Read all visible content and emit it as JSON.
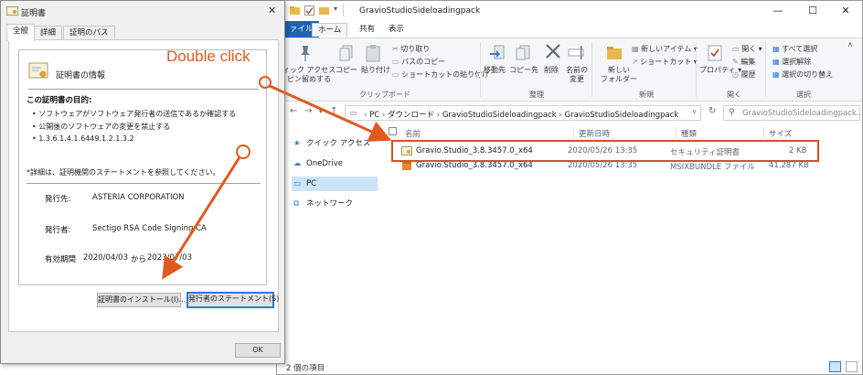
{
  "explorer": {
    "title": "GravioStudioSideloadingpack",
    "tabs": [
      "ァイル",
      "ホーム",
      "共有",
      "表示"
    ],
    "ribbon": {
      "pin_label": "ィック アクセス\nピン留めする",
      "copy_label": "コピー",
      "paste_label": "貼り付け",
      "cut": "切り取り",
      "copy_path": "パスのコピー",
      "paste_shortcut": "ショートカットの貼り付け",
      "clipboard_group": "クリップボード",
      "move_to": "移動先",
      "copy_to": "コピー先",
      "delete": "削除",
      "rename": "名前の\n変更",
      "organize_group": "整理",
      "new_folder": "新しい\nフォルダー",
      "new_item": "新しいアイテム",
      "shortcut": "ショートカット",
      "new_group": "新規",
      "properties": "プロパティ",
      "open": "開く",
      "edit": "編集",
      "history": "履歴",
      "open_group": "開く",
      "select_all": "すべて選択",
      "select_none": "選択解除",
      "invert_selection": "選択の切り替え",
      "select_group": "選択"
    },
    "address": {
      "parts": [
        "PC",
        "ダウンロード",
        "GravioStudioSideloadingpack",
        "GravioStudioSideloadingpack"
      ]
    },
    "search_placeholder": "GravioStudioSideloadingpack...",
    "nav": {
      "quick_access": "クイック アクセス",
      "onedrive": "OneDrive",
      "pc": "PC",
      "network": "ネットワーク"
    },
    "columns": {
      "name": "名前",
      "modified": "更新日時",
      "type": "種類",
      "size": "サイズ"
    },
    "files": [
      {
        "name": "Gravio.Studio_3.8.3457.0_x64",
        "modified": "2020/05/26 13:35",
        "type": "セキュリティ証明書",
        "size": "2 KB"
      },
      {
        "name": "Gravio.Studio_3.8.3457.0_x64",
        "modified": "2020/05/26 13:35",
        "type": "MSIXBUNDLE ファイル",
        "size": "41,287 KB"
      }
    ],
    "status": "2 個の項目"
  },
  "cert_dialog": {
    "title": "証明書",
    "tabs": [
      "全般",
      "詳細",
      "証明のパス"
    ],
    "info_title": "証明書の情報",
    "purpose_heading": "この証明書の目的:",
    "purposes": [
      "ソフトウェアがソフトウェア発行者の送信であるか確認する",
      "公開後のソフトウェアの変更を禁止する",
      "1.3.6.1.4.1.6449.1.2.1.3.2"
    ],
    "note": "*詳細は、証明機関のステートメントを参照してください。",
    "issued_to_label": "発行先:",
    "issued_to_value": "ASTERIA CORPORATION",
    "issued_by_label": "発行者:",
    "issued_by_value": "Sectigo RSA Code Signing CA",
    "valid_label": "有効期間",
    "valid_from": "2020/04/03",
    "valid_mid": "から",
    "valid_to": "2023/07/03",
    "install_button": "証明書のインストール(I)...",
    "statement_button": "発行者のステートメント(S)",
    "ok_button": "OK"
  },
  "annotation": {
    "double_click": "Double click",
    "color": "#e05a1f"
  }
}
